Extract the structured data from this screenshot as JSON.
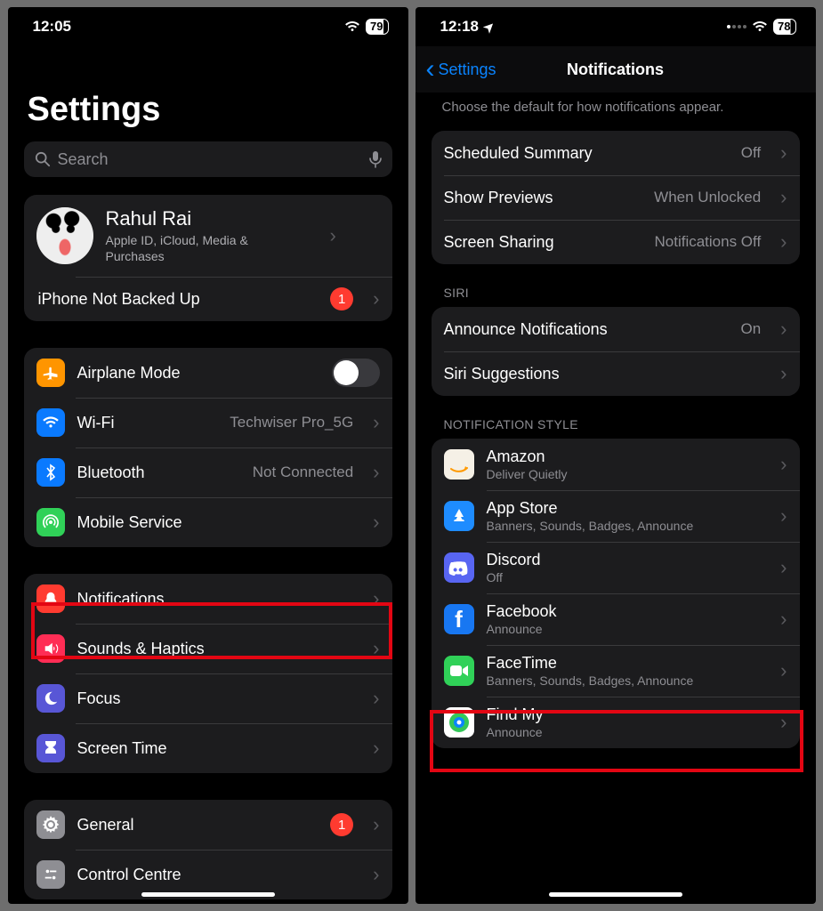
{
  "left": {
    "status": {
      "time": "12:05",
      "battery": "79"
    },
    "title": "Settings",
    "search_placeholder": "Search",
    "profile": {
      "name": "Rahul Rai",
      "sub": "Apple ID, iCloud, Media & Purchases"
    },
    "backup": {
      "label": "iPhone Not Backed Up",
      "badge": "1"
    },
    "net": {
      "airplane": "Airplane Mode",
      "wifi": "Wi-Fi",
      "wifi_val": "Techwiser Pro_5G",
      "bt": "Bluetooth",
      "bt_val": "Not Connected",
      "mobile": "Mobile Service"
    },
    "prefs": {
      "notif": "Notifications",
      "sound": "Sounds & Haptics",
      "focus": "Focus",
      "screen": "Screen Time"
    },
    "general": {
      "label": "General",
      "badge": "1"
    },
    "control": "Control Centre"
  },
  "right": {
    "status": {
      "time": "12:18",
      "battery": "78"
    },
    "back": "Settings",
    "title": "Notifications",
    "note": "Choose the default for how notifications appear.",
    "top": {
      "sched": "Scheduled Summary",
      "sched_val": "Off",
      "prev": "Show Previews",
      "prev_val": "When Unlocked",
      "share": "Screen Sharing",
      "share_val": "Notifications Off"
    },
    "siri_header": "SIRI",
    "siri": {
      "announce": "Announce Notifications",
      "announce_val": "On",
      "sugg": "Siri Suggestions"
    },
    "style_header": "NOTIFICATION STYLE",
    "apps": [
      {
        "name": "Amazon",
        "sub": "Deliver Quietly"
      },
      {
        "name": "App Store",
        "sub": "Banners, Sounds, Badges, Announce"
      },
      {
        "name": "Discord",
        "sub": "Off"
      },
      {
        "name": "Facebook",
        "sub": "Announce"
      },
      {
        "name": "FaceTime",
        "sub": "Banners, Sounds, Badges, Announce"
      },
      {
        "name": "Find My",
        "sub": "Announce"
      }
    ]
  }
}
